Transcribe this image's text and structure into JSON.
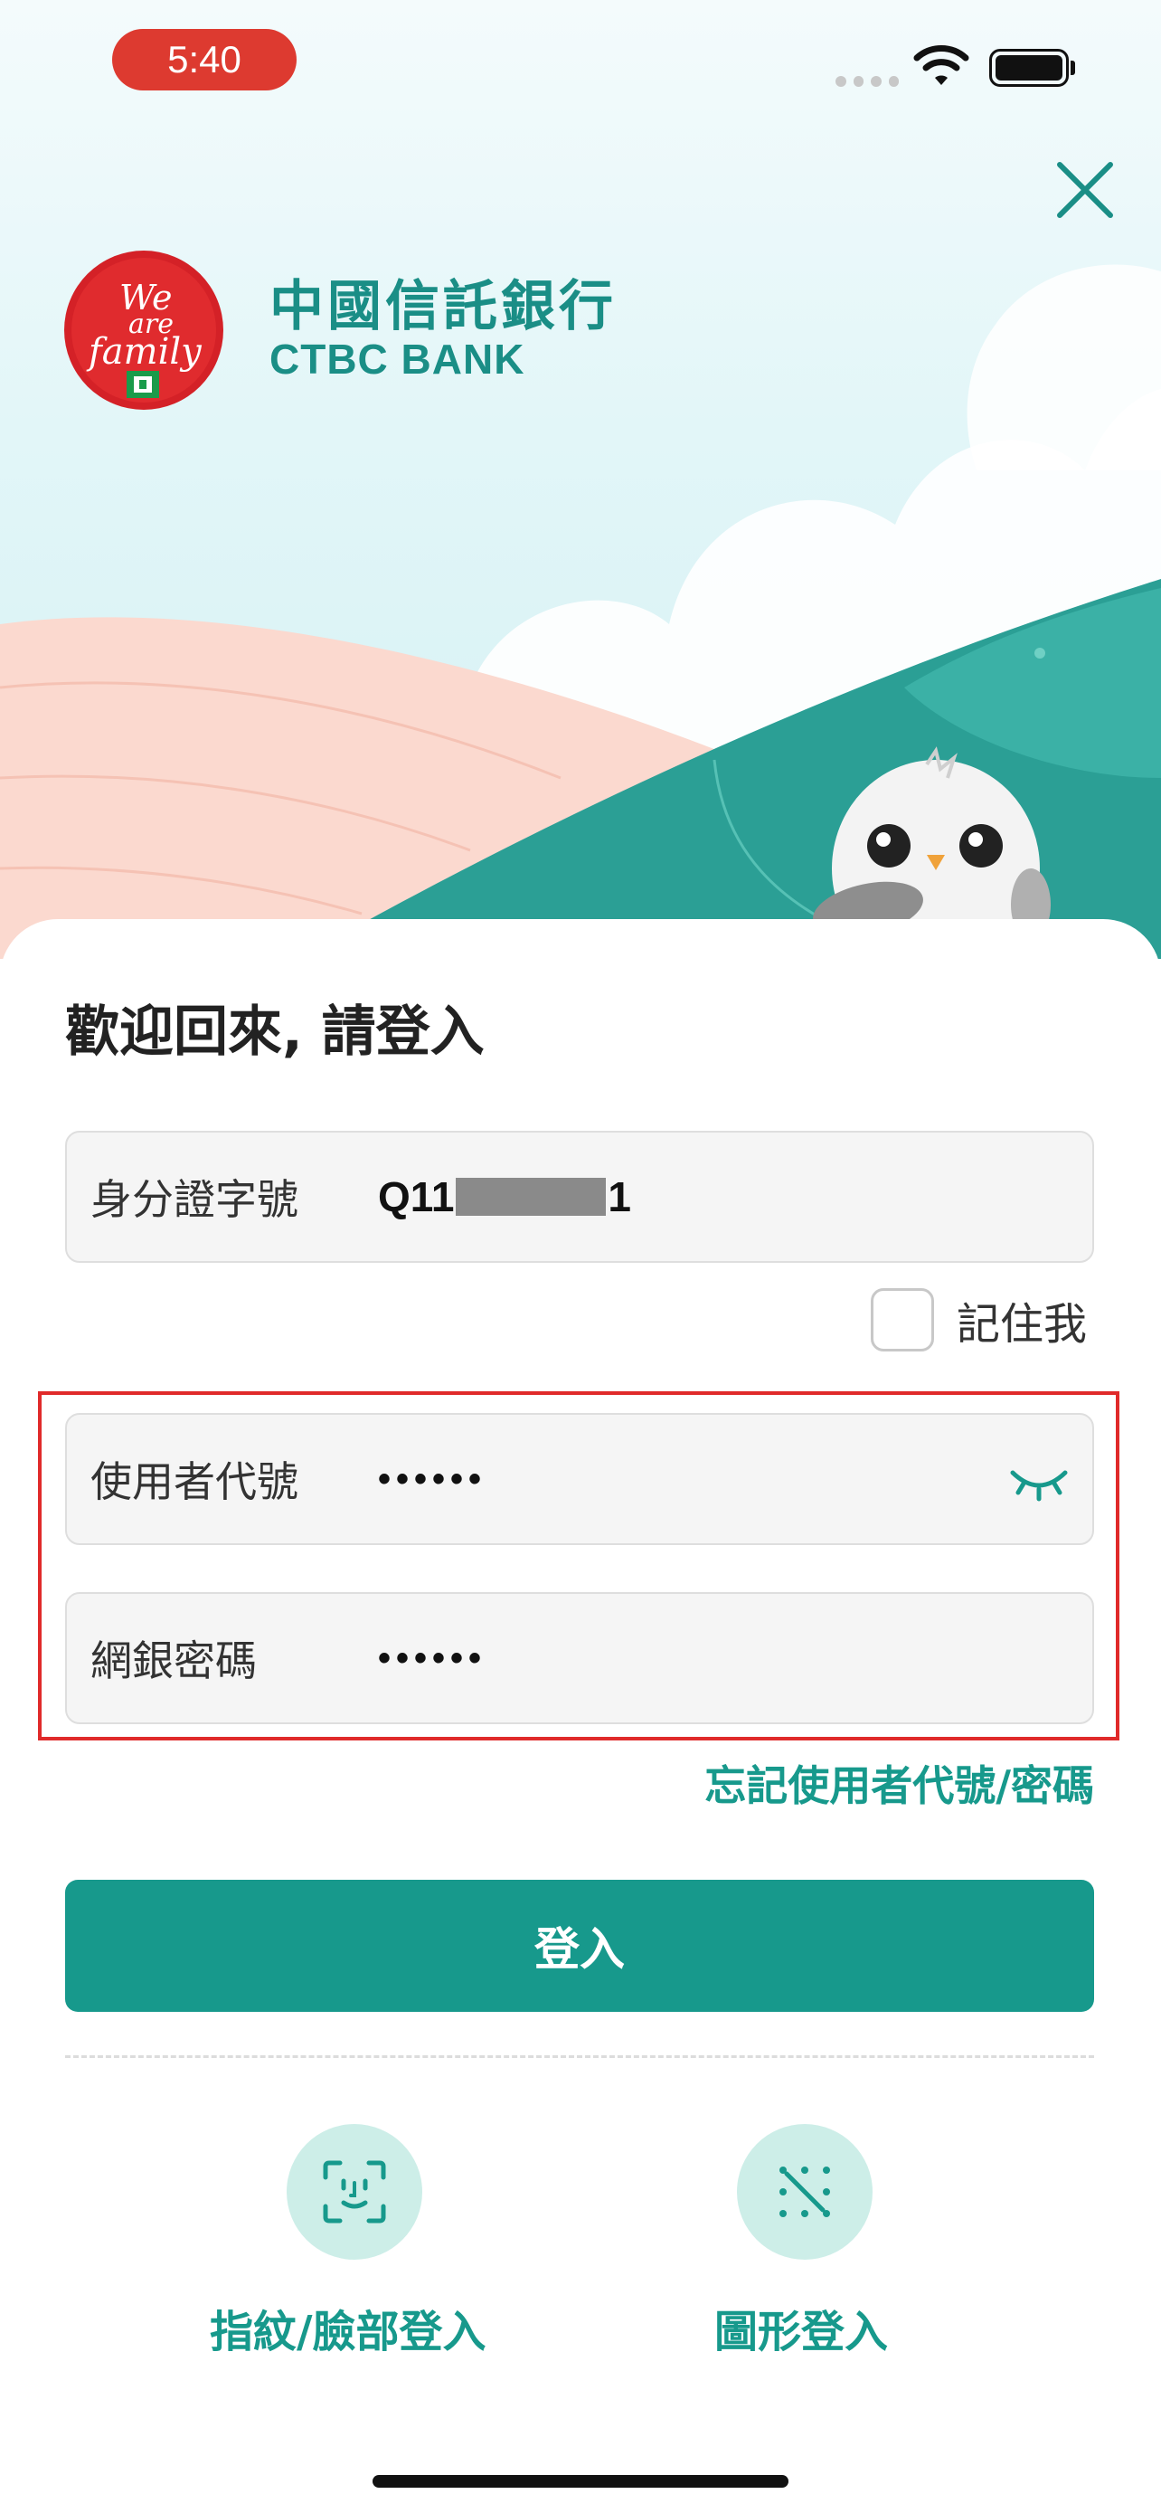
{
  "status_bar": {
    "time": "5:40"
  },
  "brand": {
    "name_cn": "中國信託銀行",
    "name_en": "CTBC BANK",
    "logo_text": "We are family"
  },
  "login": {
    "title": "歡迎回來, 請登入",
    "id_field": {
      "label": "身分證字號",
      "value_prefix": "Q11",
      "value_suffix": "1"
    },
    "remember_me": {
      "label": "記住我",
      "checked": false
    },
    "user_field": {
      "label": "使用者代號",
      "value": "••••••"
    },
    "password_field": {
      "label": "網銀密碼",
      "value": "••••••"
    },
    "forgot_link": "忘記使用者代號/密碼",
    "submit_label": "登入"
  },
  "quick_login": [
    {
      "label": "指紋/臉部登入",
      "icon": "face-id-icon"
    },
    {
      "label": "圖形登入",
      "icon": "pattern-lock-icon"
    }
  ],
  "colors": {
    "accent": "#17998c",
    "brand_text": "#1a8e86",
    "highlight_box": "#e02a2a",
    "time_pill": "#dd3a30"
  }
}
